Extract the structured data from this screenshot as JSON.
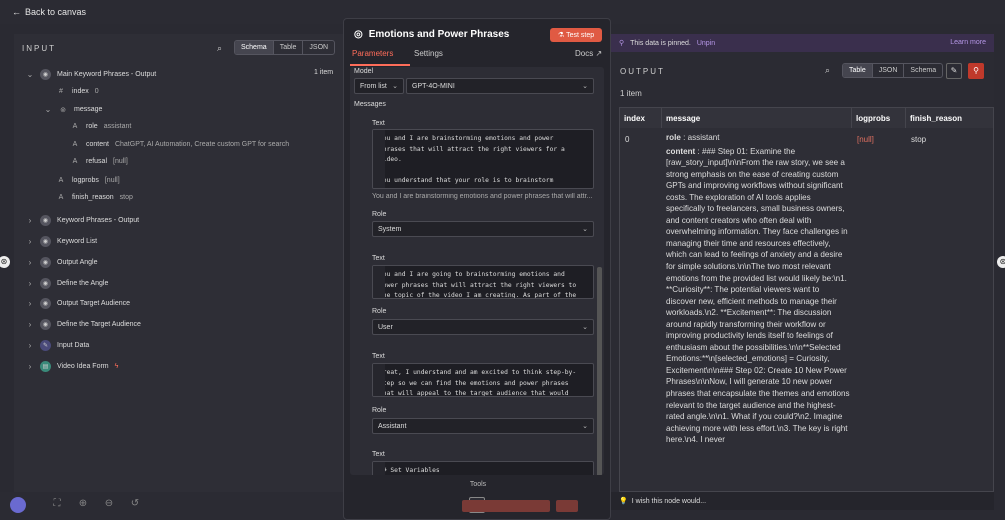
{
  "topbar": {
    "back_label": "Back to canvas"
  },
  "input_panel": {
    "title": "INPUT",
    "view_tabs": [
      "Schema",
      "Table",
      "JSON"
    ],
    "active_view": "Schema",
    "root": {
      "label": "Main Keyword Phrases - Output",
      "count": "1 item"
    },
    "fields": {
      "index": {
        "key": "index",
        "value": "0"
      },
      "message": {
        "key": "message"
      },
      "role": {
        "key": "role",
        "value": "assistant"
      },
      "content": {
        "key": "content",
        "value": "ChatGPT, AI Automation, Create custom GPT for search"
      },
      "refusal": {
        "key": "refusal",
        "value": "[null]"
      },
      "logprobs": {
        "key": "logprobs",
        "value": "[null]"
      },
      "finish_reason": {
        "key": "finish_reason",
        "value": "stop"
      }
    },
    "nodes": [
      "Keyword Phrases - Output",
      "Keyword List",
      "Output Angle",
      "Define the Angle",
      "Output Target Audience",
      "Define the Target Audience",
      "Input Data",
      "Video Idea Form"
    ]
  },
  "node_panel": {
    "title": "Emotions and Power Phrases",
    "test_step_label": "Test step",
    "tabs": {
      "parameters": "Parameters",
      "settings": "Settings",
      "docs": "Docs"
    },
    "model": {
      "label": "Model",
      "source": "From list",
      "value": "GPT-4O-MINI"
    },
    "messages_label": "Messages",
    "messages": [
      {
        "text_label": "Text",
        "text": "You and I are brainstorming emotions and power phrases that will attract the right viewers for a video.\n\nYou understand that your role is to brainstorm creatively with the established criteria.",
        "preview": "You and I are brainstorming emotions and power phrases that will attr...",
        "role_label": "Role",
        "role": "System"
      },
      {
        "text_label": "Text",
        "text": "You and I are going to brainstorming emotions and power phrases that will attract the right viewers to the topic of the video I am creating. As part of the",
        "role_label": "Role",
        "role": "User"
      },
      {
        "text_label": "Text",
        "text": "Great, I understand and am excited to think step-by-step so we can find the emotions and power phrases that will appeal to the target audience that would",
        "role_label": "Role",
        "role": "Assistant"
      },
      {
        "text_label": "Text",
        "text": "## Set Variables"
      }
    ],
    "tools_label": "Tools"
  },
  "output_panel": {
    "pinned_text": "This data is pinned.",
    "unpin_label": "Unpin",
    "learn_more_label": "Learn more",
    "title": "OUTPUT",
    "view_tabs": [
      "Table",
      "JSON",
      "Schema"
    ],
    "active_view": "Table",
    "items": "1 item",
    "columns": [
      "index",
      "message",
      "logprobs",
      "finish_reason"
    ],
    "row": {
      "index": "0",
      "role_key": "role",
      "role_value": "assistant",
      "content_key": "content",
      "content_value": "### Step 01: Examine the [raw_story_input]\\n\\nFrom the raw story, we see a strong emphasis on the ease of creating custom GPTs and improving workflows without significant costs. The exploration of AI tools applies specifically to freelancers, small business owners, and content creators who often deal with overwhelming information. They face challenges in managing their time and resources effectively, which can lead to feelings of anxiety and a desire for simple solutions.\\n\\nThe two most relevant emotions from the provided list would likely be:\\n1. **Curiosity**: The potential viewers want to discover new, efficient methods to manage their workloads.\\n2. **Excitement**: The discussion around rapidly transforming their workflow or improving productivity lends itself to feelings of enthusiasm about the possibilities.\\n\\n**Selected Emotions:**\\n[selected_emotions] = Curiosity, Excitement\\n\\n### Step 02: Create 10 New Power Phrases\\n\\nNow, I will generate 10 new power phrases that encapsulate the themes and emotions relevant to the target audience and the highest-rated angle.\\n\\n1. What if you could?\\n2. Imagine achieving more with less effort.\\n3. The key is right here.\\n4. I never",
      "logprobs": "[null]",
      "finish_reason": "stop"
    },
    "wish_text": "I wish this node would..."
  },
  "colors": {
    "accent": "#ff6d5a",
    "pinned_bg": "#3a2f4d",
    "link": "#b596e6"
  }
}
